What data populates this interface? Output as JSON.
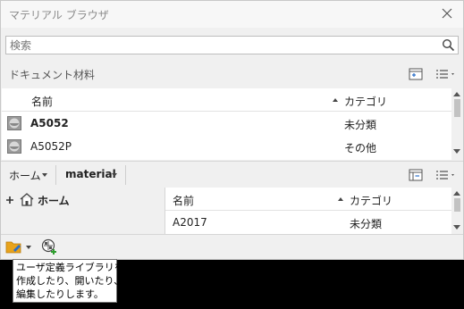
{
  "window": {
    "title": "マテリアル ブラウザ"
  },
  "search": {
    "placeholder": "検索"
  },
  "document_section": {
    "label": "ドキュメント材料"
  },
  "doc_table": {
    "columns": [
      "名前",
      "カテゴリ"
    ],
    "rows": [
      {
        "name": "A5052",
        "category": "未分類"
      },
      {
        "name": "A5052P",
        "category": "その他"
      }
    ]
  },
  "breadcrumb": {
    "items": [
      "ホーム",
      "material"
    ]
  },
  "tree": {
    "home_label": "ホーム"
  },
  "lib_table": {
    "columns": [
      "名前",
      "カテゴリ"
    ],
    "rows": [
      {
        "name": "A2017",
        "category": "未分類"
      }
    ]
  },
  "tooltip": {
    "lines": [
      "ユーザ定義ライブラリを",
      "作成したり、開いたり、",
      "編集したりします。"
    ]
  },
  "icons": {
    "close": "close-icon",
    "search": "search-icon",
    "view_toggle": "panel-view-icon",
    "list_menu": "list-menu-icon",
    "material_sphere": "material-sphere-icon",
    "home": "home-icon",
    "plus": "plus-icon",
    "library_folder": "library-folder-icon",
    "material_editor": "material-editor-icon"
  },
  "colors": {
    "accent_folder": "#e8a31c",
    "add_green": "#2e9e2e"
  }
}
